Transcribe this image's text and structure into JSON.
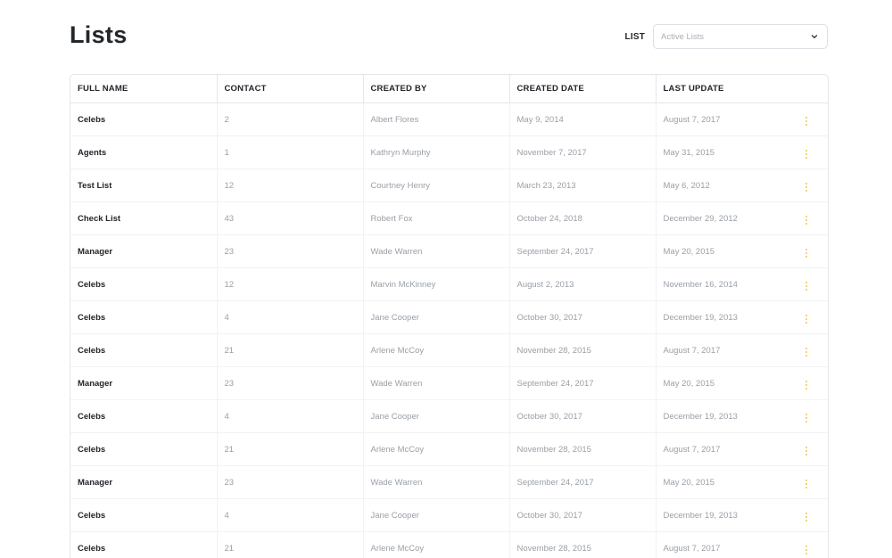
{
  "page": {
    "title": "Lists"
  },
  "filter": {
    "label": "LIST",
    "selected": "Active Lists",
    "icon": "chevron-down-icon"
  },
  "table": {
    "columns": [
      "FULL NAME",
      "CONTACT",
      "CREATED BY",
      "CREATED DATE",
      "LAST UPDATE"
    ],
    "rows": [
      {
        "name": "Celebs",
        "contact": "2",
        "created_by": "Albert Flores",
        "created_date": "May 9, 2014",
        "last_update": "August 7, 2017"
      },
      {
        "name": "Agents",
        "contact": "1",
        "created_by": "Kathryn Murphy",
        "created_date": "November 7, 2017",
        "last_update": "May 31, 2015"
      },
      {
        "name": "Test List",
        "contact": "12",
        "created_by": "Courtney Henry",
        "created_date": "March 23, 2013",
        "last_update": "May 6, 2012"
      },
      {
        "name": "Check List",
        "contact": "43",
        "created_by": "Robert Fox",
        "created_date": "October 24, 2018",
        "last_update": "December 29, 2012"
      },
      {
        "name": "Manager",
        "contact": "23",
        "created_by": "Wade Warren",
        "created_date": "September 24, 2017",
        "last_update": "May 20, 2015"
      },
      {
        "name": "Celebs",
        "contact": "12",
        "created_by": "Marvin McKinney",
        "created_date": "August 2, 2013",
        "last_update": "November 16, 2014"
      },
      {
        "name": "Celebs",
        "contact": "4",
        "created_by": "Jane Cooper",
        "created_date": "October 30, 2017",
        "last_update": "December 19, 2013"
      },
      {
        "name": "Celebs",
        "contact": "21",
        "created_by": "Arlene McCoy",
        "created_date": "November 28, 2015",
        "last_update": "August 7, 2017"
      },
      {
        "name": "Manager",
        "contact": "23",
        "created_by": "Wade Warren",
        "created_date": "September 24, 2017",
        "last_update": "May 20, 2015"
      },
      {
        "name": "Celebs",
        "contact": "4",
        "created_by": "Jane Cooper",
        "created_date": "October 30, 2017",
        "last_update": "December 19, 2013"
      },
      {
        "name": "Celebs",
        "contact": "21",
        "created_by": "Arlene McCoy",
        "created_date": "November 28, 2015",
        "last_update": "August 7, 2017"
      },
      {
        "name": "Manager",
        "contact": "23",
        "created_by": "Wade Warren",
        "created_date": "September 24, 2017",
        "last_update": "May 20, 2015"
      },
      {
        "name": "Celebs",
        "contact": "4",
        "created_by": "Jane Cooper",
        "created_date": "October 30, 2017",
        "last_update": "December 19, 2013"
      },
      {
        "name": "Celebs",
        "contact": "21",
        "created_by": "Arlene McCoy",
        "created_date": "November 28, 2015",
        "last_update": "August 7, 2017"
      }
    ],
    "row_action_icon": "more-vertical-icon"
  },
  "colors": {
    "text_dark": "#23262b",
    "text_muted": "#9aa0a7",
    "border": "#e3e6ea",
    "accent_kebab": "#f6c54a"
  }
}
